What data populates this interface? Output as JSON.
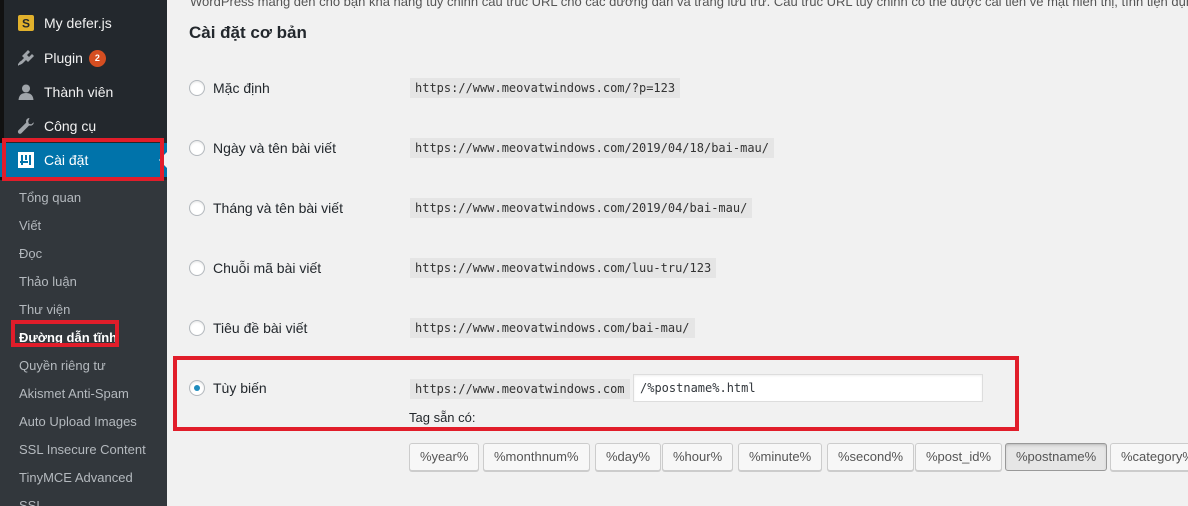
{
  "sidebar": {
    "menu": [
      {
        "icon": "plugin-s-icon",
        "label": "My defer.js"
      },
      {
        "icon": "plugin-icon",
        "label": "Plugin",
        "badge": "2"
      },
      {
        "icon": "user-icon",
        "label": "Thành viên"
      },
      {
        "icon": "wrench-icon",
        "label": "Công cụ"
      },
      {
        "icon": "settings-icon",
        "label": "Cài đặt"
      }
    ],
    "submenu": [
      "Tổng quan",
      "Viết",
      "Đọc",
      "Thảo luận",
      "Thư viện",
      "Đường dẫn tĩnh",
      "Quyền riêng tư",
      "Akismet Anti-Spam",
      "Auto Upload Images",
      "SSL Insecure Content",
      "TinyMCE Advanced",
      "SSL"
    ]
  },
  "main": {
    "intro_text": "WordPress mang đến cho bạn khả năng tùy chỉnh cấu trúc URL cho các đường dẫn và trang lưu trữ. Cấu trúc URL tùy chỉnh có thể được cải tiến về mặt hiển thị, tính tiện dụng",
    "section_title": "Cài đặt cơ bản",
    "options": [
      {
        "label": "Mặc định",
        "example": "https://www.meovatwindows.com/?p=123",
        "checked": false
      },
      {
        "label": "Ngày và tên bài viết",
        "example": "https://www.meovatwindows.com/2019/04/18/bai-mau/",
        "checked": false
      },
      {
        "label": "Tháng và tên bài viết",
        "example": "https://www.meovatwindows.com/2019/04/bai-mau/",
        "checked": false
      },
      {
        "label": "Chuỗi mã bài viết",
        "example": "https://www.meovatwindows.com/luu-tru/123",
        "checked": false
      },
      {
        "label": "Tiêu đề bài viết",
        "example": "https://www.meovatwindows.com/bai-mau/",
        "checked": false
      },
      {
        "label": "Tùy biến",
        "example": "https://www.meovatwindows.com",
        "checked": true
      }
    ],
    "custom_structure_value": "/%postname%.html",
    "tags_label": "Tag sẵn có:",
    "tags": [
      "%year%",
      "%monthnum%",
      "%day%",
      "%hour%",
      "%minute%",
      "%second%",
      "%post_id%",
      "%postname%",
      "%category%"
    ],
    "active_tag": "%postname%"
  },
  "colors": {
    "sidebar_bg": "#23282d",
    "submenu_bg": "#32373c",
    "current_menu": "#0073aa",
    "highlight": "#e11d2a",
    "badge": "#d54e21"
  }
}
